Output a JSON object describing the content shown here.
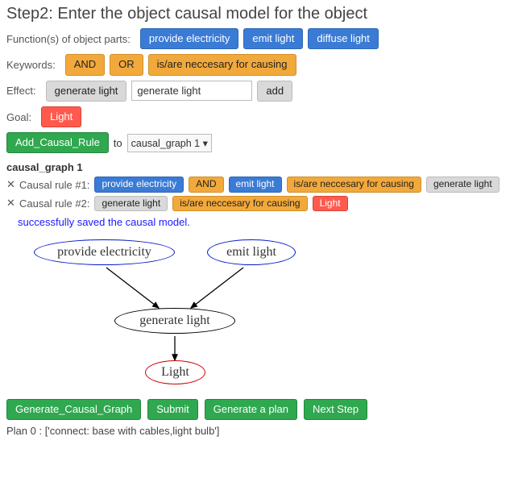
{
  "title": "Step2: Enter the object causal model for the object",
  "functions": {
    "label": "Function(s) of object parts:",
    "items": [
      "provide electricity",
      "emit light",
      "diffuse light"
    ]
  },
  "keywords": {
    "label": "Keywords:",
    "and": "AND",
    "or": "OR",
    "necessary": "is/are neccesary for causing"
  },
  "effect": {
    "label": "Effect:",
    "button": "generate light",
    "input_value": "generate light",
    "add": "add"
  },
  "goal": {
    "label": "Goal:",
    "value": "Light"
  },
  "add_rule": {
    "button": "Add_Causal_Rule",
    "to": "to",
    "select": "causal_graph 1"
  },
  "graph_title": "causal_graph 1",
  "rules": [
    {
      "label": "Causal rule #1:",
      "tokens": [
        {
          "text": "provide electricity",
          "cls": "chip-blue"
        },
        {
          "text": "AND",
          "cls": "chip-amber"
        },
        {
          "text": "emit light",
          "cls": "chip-blue"
        },
        {
          "text": "is/are neccesary for causing",
          "cls": "chip-amber"
        },
        {
          "text": "generate light",
          "cls": "chip-gray"
        }
      ]
    },
    {
      "label": "Causal rule #2:",
      "tokens": [
        {
          "text": "generate light",
          "cls": "chip-gray"
        },
        {
          "text": "is/are neccesary for causing",
          "cls": "chip-amber"
        },
        {
          "text": "Light",
          "cls": "chip-red"
        }
      ]
    }
  ],
  "save_msg": "successfully saved the causal model.",
  "graph_nodes": {
    "n1": "provide electricity",
    "n2": "emit light",
    "n3": "generate light",
    "n4": "Light"
  },
  "actions": {
    "gen_graph": "Generate_Causal_Graph",
    "submit": "Submit",
    "gen_plan": "Generate a plan",
    "next": "Next Step"
  },
  "plan": "Plan 0 : ['connect: base with cables,light bulb']"
}
